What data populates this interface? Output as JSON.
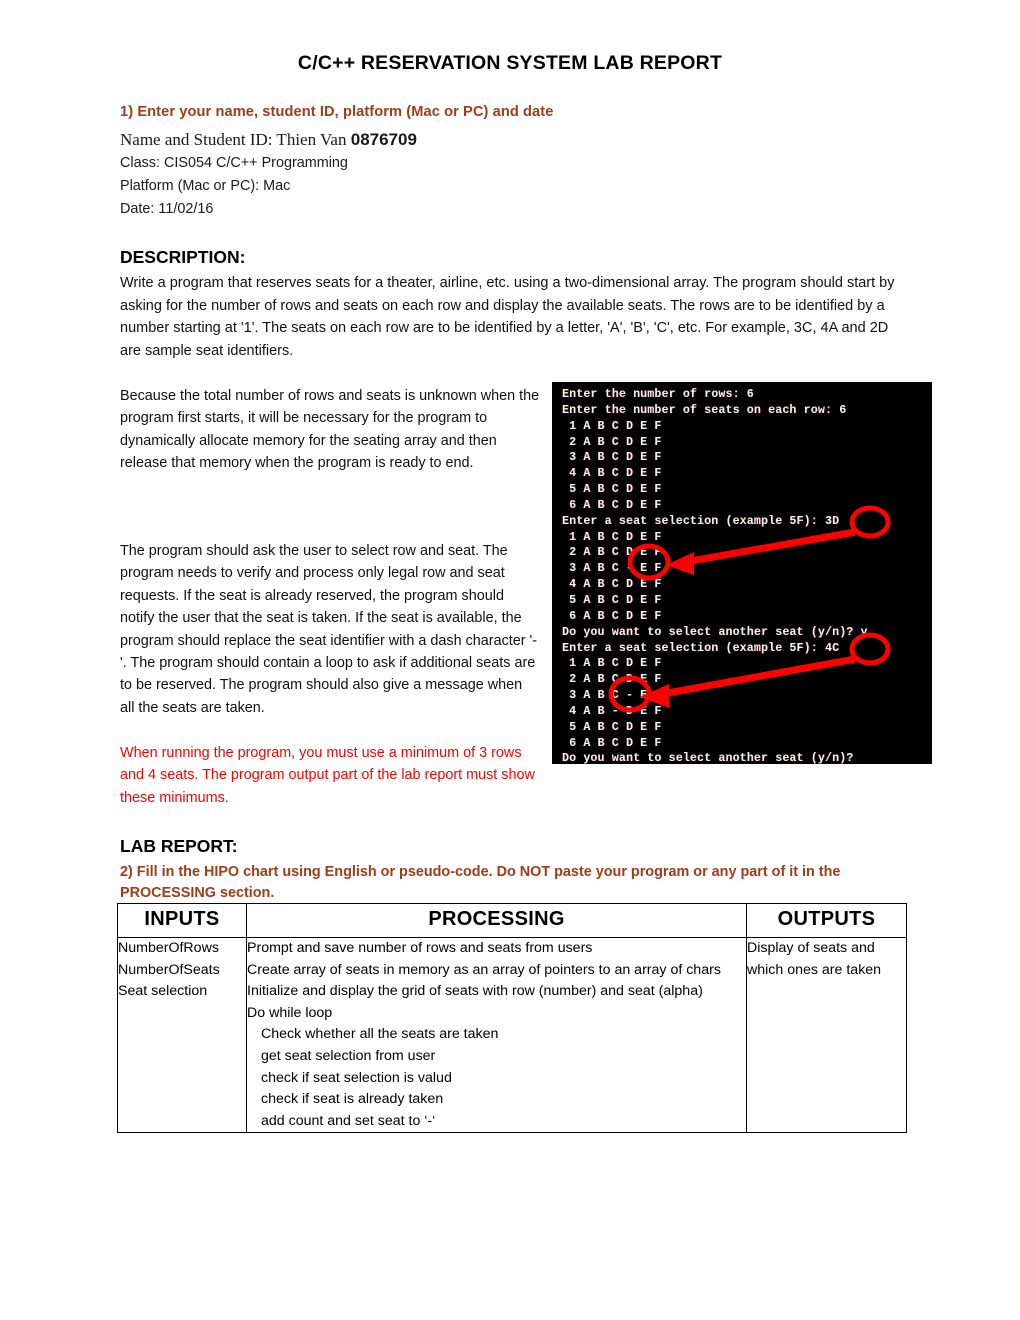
{
  "document": {
    "title": "C/C++  RESERVATION SYSTEM LAB REPORT"
  },
  "section1": {
    "heading": "1) Enter your name, student ID, platform (Mac or PC) and date",
    "name_label": "Name and Student ID: Thien Van ",
    "student_id": "0876709",
    "class_line": "Class:  CIS054  C/C++ Programming",
    "platform_line": "Platform (Mac or PC):  Mac",
    "date_line": "Date:   11/02/16"
  },
  "description": {
    "heading": "DESCRIPTION:",
    "body": "Write a program that reserves seats for a theater, airline, etc. using a two-dimensional array. The program should start by asking for the number of rows and seats on each row and display the available seats. The rows are to be identified by a number starting at '1'. The seats on each row are to be identified by a letter, 'A', 'B', 'C', etc. For example, 3C, 4A and 2D are sample seat identifiers.",
    "paragraph_1": "Because the total number of rows and seats is unknown when the program first starts, it will be necessary for the program to dynamically allocate memory for the seating array and then release that memory when the program is ready to end.",
    "paragraph_2": "The program should ask the user to select row and seat. The program needs to verify and process only legal row and seat requests. If the seat is already reserved, the program should notify the user that the seat is taken. If the seat is available, the program should replace the seat identifier with a dash character '-'. The program should contain a loop to ask if additional seats are to be reserved. The program should also give a message when all the seats are taken.",
    "paragraph_red": "When running the program, you must use a minimum of 3 rows and 4 seats. The program output part of the lab report must show these minimums."
  },
  "terminal": {
    "background_color": "#000000",
    "text_color": "#f2f2f2",
    "annotation_color": "#FF0000",
    "rows_entered": "6",
    "seats_entered": "6",
    "selection_1": "3D",
    "selection_2": "4C",
    "continue_answer": "y",
    "output": "Enter the number of rows: 6\nEnter the number of seats on each row: 6\n 1 A B C D E F\n 2 A B C D E F\n 3 A B C D E F\n 4 A B C D E F\n 5 A B C D E F\n 6 A B C D E F\nEnter a seat selection (example 5F): 3D\n 1 A B C D E F\n 2 A B C D E F\n 3 A B C - E F\n 4 A B C D E F\n 5 A B C D E F\n 6 A B C D E F\nDo you want to select another seat (y/n)? y\nEnter a seat selection (example 5F): 4C\n 1 A B C D E F\n 2 A B C D E F\n 3 A B C - E F\n 4 A B - D E F\n 5 A B C D E F\n 6 A B C D E F\nDo you want to select another seat (y/n)?"
  },
  "lab_report": {
    "heading": "LAB REPORT:",
    "q2_heading": "2) Fill in the HIPO chart using English or pseudo-code. Do NOT paste your program or any part of it in the PROCESSING section.",
    "table": {
      "headers": [
        "INPUTS",
        "PROCESSING",
        "OUTPUTS"
      ],
      "inputs": [
        "NumberOfRows",
        "NumberOfSeats",
        "Seat selection"
      ],
      "processing": [
        {
          "text": "Prompt and save number of rows and seats from users",
          "indent": 0
        },
        {
          "text": "Create array of seats in memory as an array of pointers to an array of chars",
          "indent": 0
        },
        {
          "text": "Initialize and display the grid of seats with row (number) and seat (alpha)",
          "indent": 0
        },
        {
          "text": "Do while loop",
          "indent": 0
        },
        {
          "text": "Check whether all the seats are taken",
          "indent": 1
        },
        {
          "text": "get seat selection from user",
          "indent": 1
        },
        {
          "text": "check if seat selection is valud",
          "indent": 1
        },
        {
          "text": "check if seat is already taken",
          "indent": 1
        },
        {
          "text": "add count and set seat to ‘-‘",
          "indent": 1
        }
      ],
      "outputs": [
        "Display of seats and which ones are taken"
      ]
    }
  }
}
